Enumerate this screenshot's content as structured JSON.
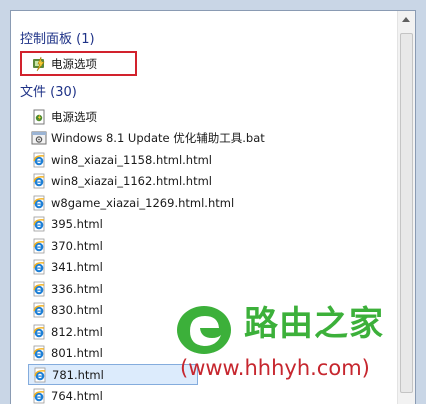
{
  "control_panel": {
    "header": "控制面板 (1)",
    "items": [
      {
        "label": "电源选项",
        "icon": "power-options-icon"
      }
    ]
  },
  "files": {
    "header": "文件 (30)",
    "items": [
      {
        "label": "电源选项",
        "icon": "power-document-icon"
      },
      {
        "label": "Windows 8.1 Update 优化辅助工具.bat",
        "icon": "batch-file-icon"
      },
      {
        "label": "win8_xiazai_1158.html.html",
        "icon": "ie-html-icon"
      },
      {
        "label": "win8_xiazai_1162.html.html",
        "icon": "ie-html-icon"
      },
      {
        "label": "w8game_xiazai_1269.html.html",
        "icon": "ie-html-icon"
      },
      {
        "label": "395.html",
        "icon": "ie-html-icon"
      },
      {
        "label": "370.html",
        "icon": "ie-html-icon"
      },
      {
        "label": "341.html",
        "icon": "ie-html-icon"
      },
      {
        "label": "336.html",
        "icon": "ie-html-icon"
      },
      {
        "label": "830.html",
        "icon": "ie-html-icon"
      },
      {
        "label": "812.html",
        "icon": "ie-html-icon"
      },
      {
        "label": "801.html",
        "icon": "ie-html-icon"
      },
      {
        "label": "781.html",
        "icon": "ie-html-icon"
      },
      {
        "label": "764.html",
        "icon": "ie-html-icon"
      }
    ],
    "selected_index": 12
  },
  "watermark": {
    "wordmark": "路由之家",
    "url": "(www.hhhyh.com)"
  },
  "colors": {
    "header_text": "#1e3287",
    "highlight_border": "#d2222d",
    "selection_fill": "#dcebfc",
    "watermark_green": "#3cb03a",
    "watermark_red": "#c6262e"
  }
}
